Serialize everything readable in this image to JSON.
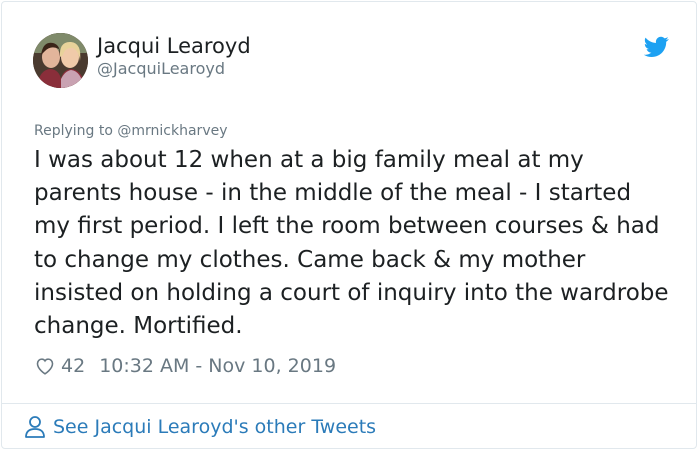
{
  "author": {
    "name": "Jacqui Learoyd",
    "handle": "@JacquiLearoyd"
  },
  "reply_to": {
    "prefix": "Replying to",
    "mention": "@mrnickharvey"
  },
  "tweet": {
    "text": "I was about 12 when at a big family meal at my parents house - in the middle of the meal - I started my first period. I left the room between courses & had to change my clothes. Came back & my mother insisted on holding a court of inquiry into the wardrobe change. Mortified."
  },
  "meta": {
    "likes": "42",
    "timestamp": "10:32 AM - Nov 10, 2019"
  },
  "footer": {
    "link_label": "See Jacqui Learoyd's other Tweets"
  },
  "icons": {
    "brand": "twitter-bird-icon",
    "like": "heart-icon",
    "profile": "user-icon"
  },
  "colors": {
    "brand": "#1da1f2",
    "link": "#2b7bb9",
    "text": "#1c2022",
    "muted": "#697882",
    "border": "#e1e8ed"
  }
}
